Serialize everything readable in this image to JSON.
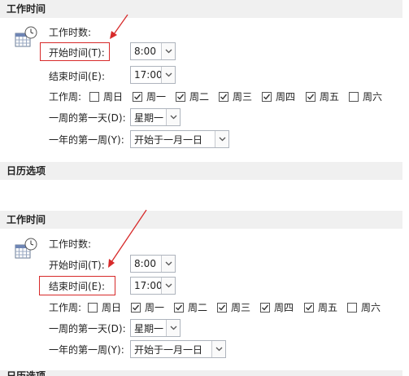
{
  "panel1": {
    "header": "工作时间",
    "hours_label": "工作时数:",
    "start_label": "开始时间(T):",
    "start_value": "8:00",
    "end_label": "结束时间(E):",
    "end_value": "17:00",
    "week_label": "工作周:",
    "days": [
      "周日",
      "周一",
      "周二",
      "周三",
      "周四",
      "周五",
      "周六"
    ],
    "days_checked": [
      false,
      true,
      true,
      true,
      true,
      true,
      false
    ],
    "firstday_label": "一周的第一天(D):",
    "firstday_value": "星期一",
    "firstweek_label": "一年的第一周(Y):",
    "firstweek_value": "开始于一月一日"
  },
  "calendar_options_header": "日历选项",
  "panel2": {
    "header": "工作时间",
    "hours_label": "工作时数:",
    "start_label": "开始时间(T):",
    "start_value": "8:00",
    "end_label": "结束时间(E):",
    "end_value": "17:00",
    "week_label": "工作周:",
    "days": [
      "周日",
      "周一",
      "周二",
      "周三",
      "周四",
      "周五",
      "周六"
    ],
    "days_checked": [
      false,
      true,
      true,
      true,
      true,
      true,
      false
    ],
    "firstday_label": "一周的第一天(D):",
    "firstday_value": "星期一",
    "firstweek_label": "一年的第一周(Y):",
    "firstweek_value": "开始于一月一日"
  },
  "bottom_header": "日历选项",
  "colors": {
    "highlight": "#d72a2a",
    "header_bg": "#f0f0f0"
  }
}
